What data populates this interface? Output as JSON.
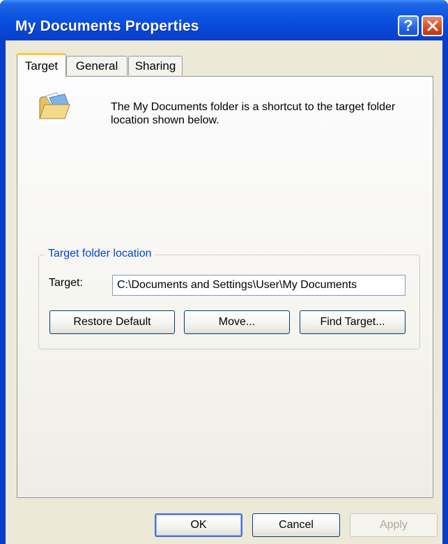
{
  "window": {
    "title": "My Documents Properties",
    "help_glyph": "?",
    "accent": "#0a53e0",
    "close_color": "#d9502a"
  },
  "tabs": [
    {
      "label": "Target",
      "active": true
    },
    {
      "label": "General",
      "active": false
    },
    {
      "label": "Sharing",
      "active": false
    }
  ],
  "panel": {
    "icon": "open-folder-icon",
    "description": "The My Documents folder is a shortcut to the target folder location shown below."
  },
  "target_group": {
    "legend": "Target folder location",
    "legend_color": "#0046d5",
    "target_label": "Target:",
    "target_value": "C:\\Documents and Settings\\User\\My Documents",
    "buttons": {
      "restore": "Restore Default",
      "move": "Move...",
      "find": "Find Target..."
    }
  },
  "footer": {
    "ok": "OK",
    "cancel": "Cancel",
    "apply": "Apply",
    "apply_enabled": false
  }
}
